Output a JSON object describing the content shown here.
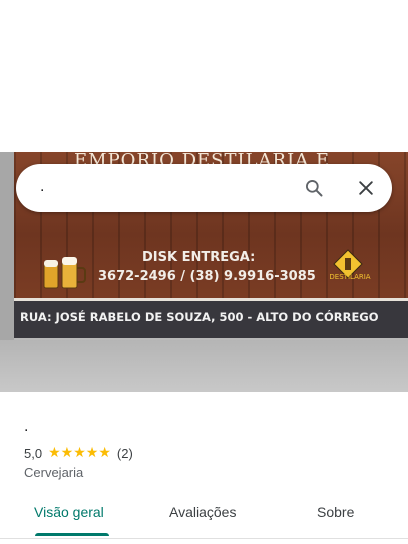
{
  "search": {
    "query": "."
  },
  "photo": {
    "sign_title_top": "EMPÓRIO DESTILARIA E",
    "disk_label": "DISK ENTREGA:",
    "disk_phones": "3672-2496 / (38) 9.9916-3085",
    "brand_logo_text": "DESTILARIA",
    "address": "RUA: JOSÉ RABELO DE SOUZA, 500 - ALTO DO CÓRREGO"
  },
  "place": {
    "name": ".",
    "rating": "5,0",
    "stars_count": 5,
    "review_count": "(2)",
    "category": "Cervejaria"
  },
  "tabs": [
    {
      "label": "Visão geral",
      "active": true
    },
    {
      "label": "Avaliações",
      "active": false
    },
    {
      "label": "Sobre",
      "active": false
    }
  ],
  "colors": {
    "accent": "#00796b",
    "star": "#fbbc04"
  },
  "icons": {
    "search": "search-icon",
    "close": "close-icon"
  }
}
